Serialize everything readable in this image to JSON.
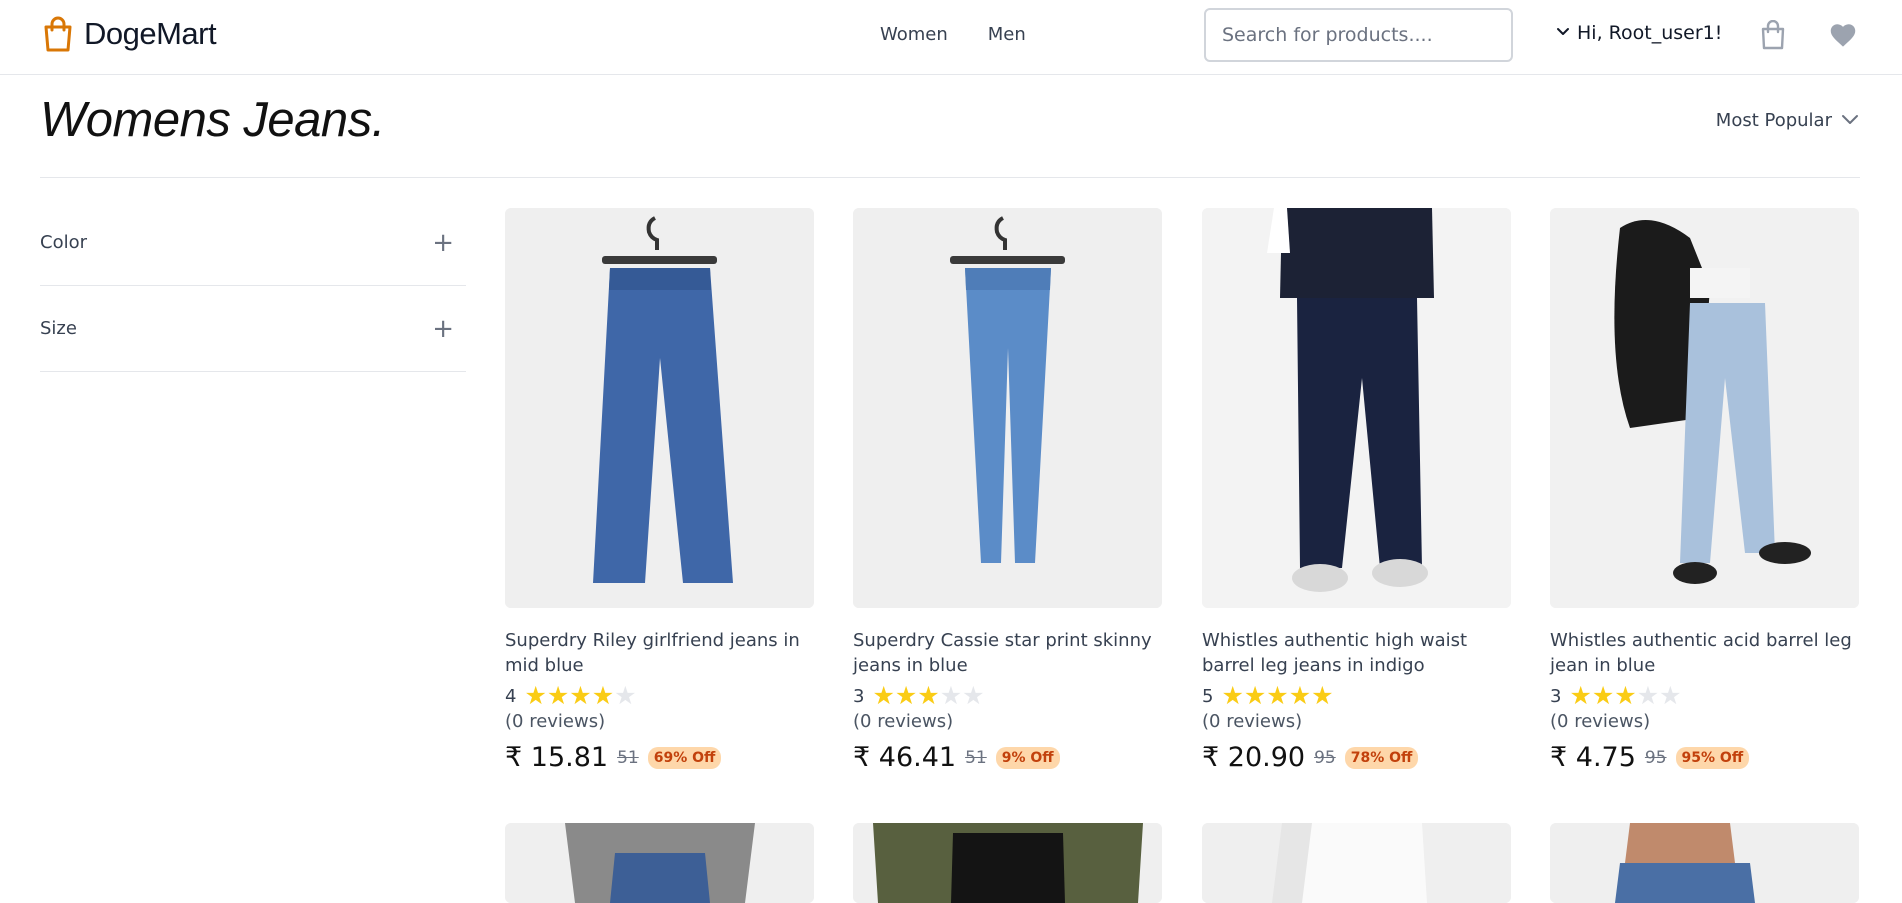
{
  "header": {
    "logo_text": "DogeMart",
    "brand_color": "#d97706",
    "nav": [
      "Women",
      "Men"
    ],
    "search_placeholder": "Search for products....",
    "greeting": "Hi, Root_user1!",
    "icons": [
      "shopping-bag-icon",
      "heart-icon",
      "chevron-down-icon"
    ]
  },
  "page": {
    "title": "Womens Jeans.",
    "sort_label": "Most Popular"
  },
  "filters": [
    {
      "label": "Color"
    },
    {
      "label": "Size"
    }
  ],
  "currency_symbol": "₹",
  "products": [
    {
      "name": "Superdry Riley girlfriend jeans in mid blue",
      "rating": "4",
      "stars": 4,
      "reviews": "(0 reviews)",
      "price": "15.81",
      "mrp": "51",
      "discount": "69% Off"
    },
    {
      "name": "Superdry Cassie star print skinny jeans in blue",
      "rating": "3",
      "stars": 3,
      "reviews": "(0 reviews)",
      "price": "46.41",
      "mrp": "51",
      "discount": "9% Off"
    },
    {
      "name": "Whistles authentic high waist barrel leg jeans in indigo",
      "rating": "5",
      "stars": 5,
      "reviews": "(0 reviews)",
      "price": "20.90",
      "mrp": "95",
      "discount": "78% Off"
    },
    {
      "name": "Whistles authentic acid barrel leg jean in blue",
      "rating": "3",
      "stars": 3,
      "reviews": "(0 reviews)",
      "price": "4.75",
      "mrp": "95",
      "discount": "95% Off"
    }
  ]
}
